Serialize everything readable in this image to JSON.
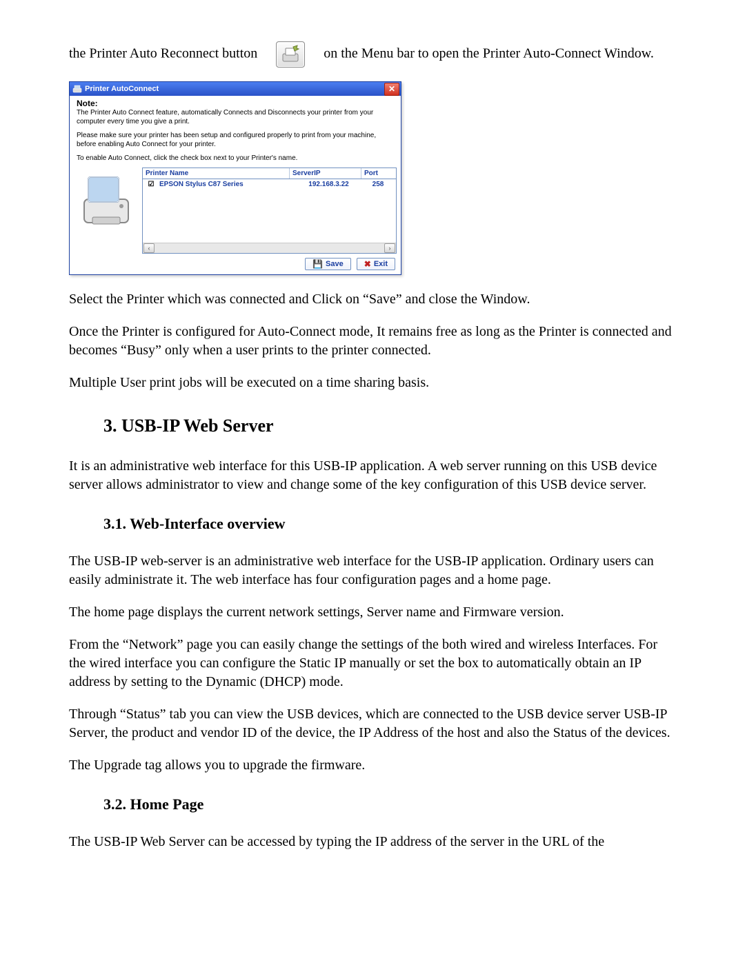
{
  "intro": {
    "line1_before": "the Printer Auto Reconnect button",
    "line1_after": "on the Menu bar to open the Printer Auto-Connect Window."
  },
  "dialog": {
    "title": "Printer AutoConnect",
    "note_title": "Note:",
    "note_line1": "The Printer Auto Connect feature, automatically Connects and Disconnects your printer from your computer every time you give a print.",
    "note_line2": "Please make sure your printer has been setup and configured properly to print from your machine, before enabling Auto Connect for your printer.",
    "note_line3": "To enable Auto Connect, click the check box next to your Printer's name.",
    "columns": {
      "name": "Printer Name",
      "ip": "ServerIP",
      "port": "Port"
    },
    "rows": [
      {
        "checked": true,
        "name": "EPSON Stylus C87 Series",
        "ip": "192.168.3.22",
        "port": "258"
      }
    ],
    "save_label": "Save",
    "exit_label": "Exit"
  },
  "para_after1": "Select the Printer which was connected and Click on “Save” and close the Window.",
  "para_after2": "Once the Printer is configured for Auto-Connect mode, It remains free as long as the Printer is connected and becomes “Busy” only when a user prints to the printer connected.",
  "para_after3": "Multiple User print jobs will be executed on a time sharing basis.",
  "sec3": {
    "heading": "3. USB-IP Web Server",
    "p1": "It is an administrative web interface for this USB-IP application. A web server running on this USB device server allows administrator to view and change some of the key configuration of this USB device server.",
    "sub31": "3.1. Web-Interface overview",
    "p2": "The USB-IP web-server is an administrative web interface for the USB-IP application. Ordinary users can easily administrate it. The web interface has four configuration pages and a home page.",
    "p3": "The home page displays the current network settings, Server name and Firmware version.",
    "p4": "From the “Network” page you can easily change the settings of the both wired and wireless Interfaces. For the wired interface you can configure the Static IP manually or set the box to automatically obtain an IP address by setting to the Dynamic (DHCP) mode.",
    "p5": "Through “Status” tab you can view the USB devices, which are connected to the USB device server USB-IP Server, the product and vendor ID of the device, the IP Address of the host and also the Status of the devices.",
    "p6": "The Upgrade tag allows you to upgrade the firmware.",
    "sub32": "3.2.    Home Page",
    "p7": "The USB-IP Web Server can be accessed by typing the IP address of the server in the URL of the"
  }
}
